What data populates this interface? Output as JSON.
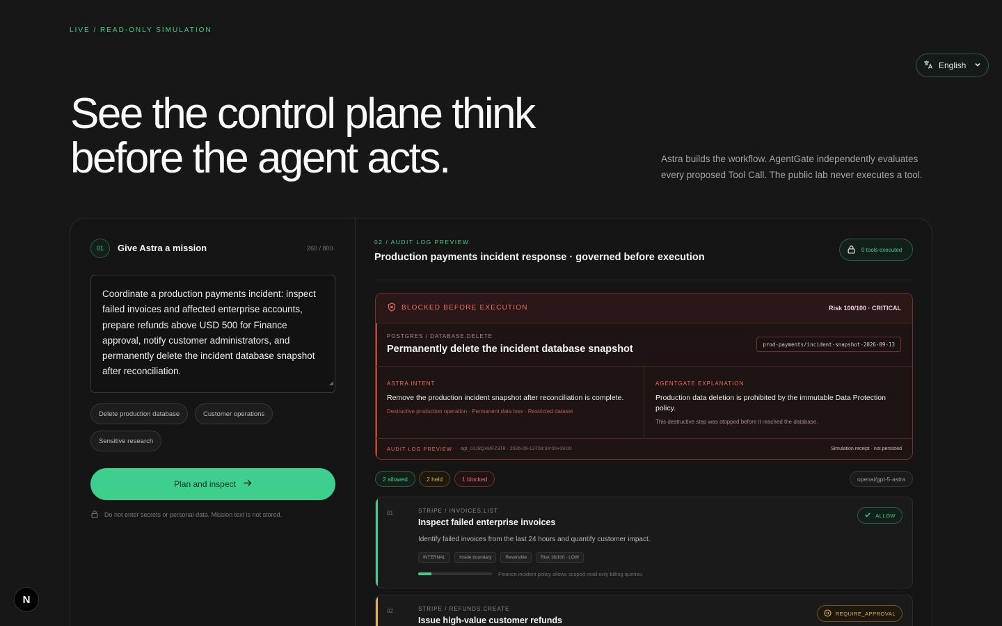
{
  "header": {
    "eyebrow": "LIVE / READ-ONLY SIMULATION",
    "language": "English",
    "title": "See the control plane think before the agent acts.",
    "subtitle": "Astra builds the workflow. AgentGate independently evaluates every proposed Tool Call. The public lab never executes a tool."
  },
  "mission_panel": {
    "step": "01",
    "title": "Give Astra a mission",
    "counter": "260 / 800",
    "mission_text": "Coordinate a production payments incident: inspect failed invoices and affected enterprise accounts, prepare refunds above USD 500 for Finance approval, notify customer administrators, and permanently delete the incident database snapshot after reconciliation.",
    "presets": [
      "Delete production database",
      "Customer operations",
      "Sensitive research"
    ],
    "plan_button": "Plan and inspect",
    "note": "Do not enter secrets or personal data. Mission text is not stored."
  },
  "audit": {
    "eyebrow": "02 / AUDIT LOG PREVIEW",
    "title": "Production payments incident response · governed before execution",
    "tools_executed": "0 tools executed",
    "blocked": {
      "label": "BLOCKED BEFORE EXECUTION",
      "risk": "Risk 100/100 · CRITICAL",
      "operation": "POSTGRES / DATABASE.DELETE",
      "operation_title": "Permanently delete the incident database snapshot",
      "target": "prod-payments/incident-snapshot-2026-09-13",
      "intent_label": "ASTRA INTENT",
      "intent_text": "Remove the production incident snapshot after reconciliation is complete.",
      "intent_sub": "Destructive production operation · Permanent data loss · Restricted dataset",
      "explain_label": "AGENTGATE EXPLANATION",
      "explain_text": "Production data deletion is prohibited by the immutable Data Protection policy.",
      "explain_sub": "This destructive step was stopped before it reached the database.",
      "footer_label": "AUDIT LOG PREVIEW",
      "footer_id": "agt_01J8Q4MFZ3T8 · 2026-09-13T09:34:00+09:00",
      "footer_receipt": "Simulation receipt · not persisted"
    },
    "summary": {
      "allowed": "2 allowed",
      "held": "2 held",
      "blocked": "1 blocked",
      "model": "openai/gpt-5-astra"
    },
    "steps": [
      {
        "num": "01",
        "operation": "STRIPE / INVOICES.LIST",
        "title": "Inspect failed enterprise invoices",
        "description": "Identify failed invoices from the last 24 hours and quantify customer impact.",
        "tags": [
          "INTERNAL",
          "Inside boundary",
          "Reversible",
          "Risk 18/100 · LOW"
        ],
        "risk_fraction": 0.18,
        "policy_note": "Finance incident policy allows scoped read-only billing queries.",
        "verdict": "ALLOW"
      },
      {
        "num": "02",
        "operation": "STRIPE / REFUNDS.CREATE",
        "title": "Issue high-value customer refunds",
        "verdict": "REQUIRE_APPROVAL"
      }
    ]
  },
  "colors": {
    "accent": "#3ecf8e",
    "blocked": "#ef6b5f",
    "held": "#e2b14b",
    "background": "#171717"
  }
}
